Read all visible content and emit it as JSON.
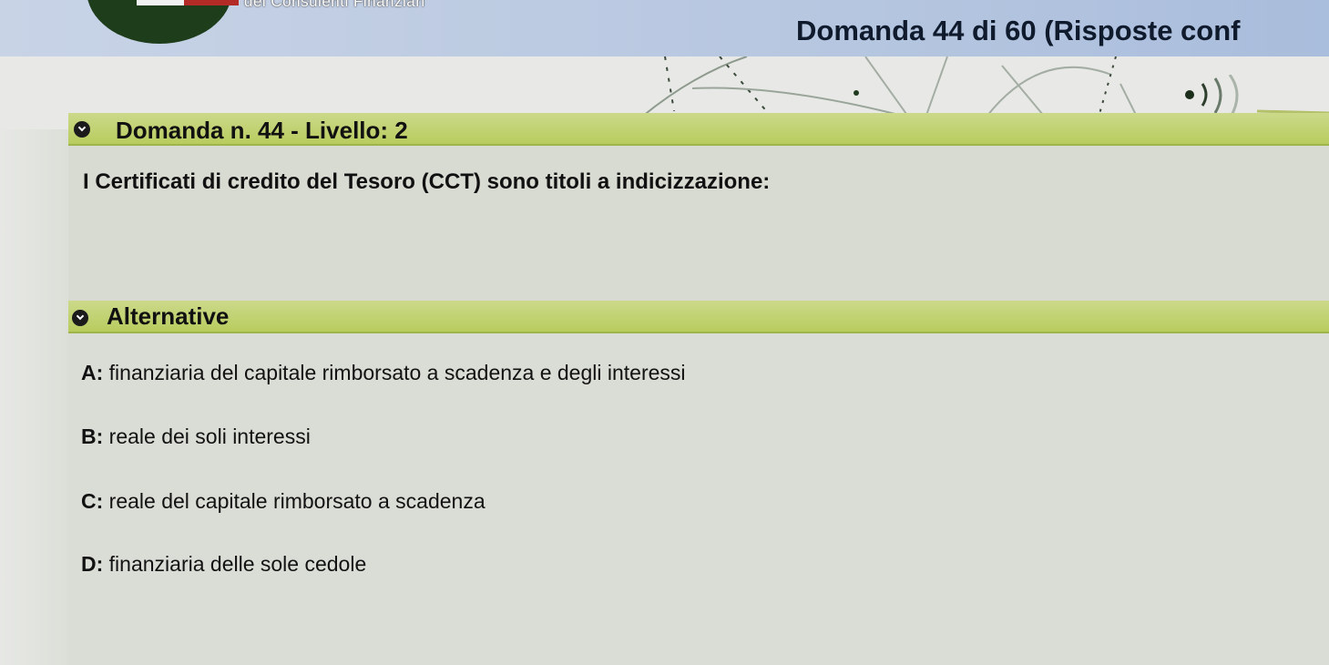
{
  "header": {
    "org_subtitle": "dei Consulenti Finanziari",
    "exam_title": "Domanda 44 di 60 (Risposte conf"
  },
  "colors": {
    "header_bg": "#b7c7e0",
    "section_bar": "#c2d274",
    "logo_green": "#1e3d1b",
    "logo_red": "#b32b27"
  },
  "icons": {
    "audio": "audio-speaker-icon",
    "section_bullet": "chevron-down-circle-icon"
  },
  "question": {
    "heading": "Domanda n. 44 - Livello: 2",
    "text": "I Certificati di credito del Tesoro (CCT) sono titoli a indicizzazione:"
  },
  "alternatives": {
    "heading": "Alternative",
    "items": [
      {
        "letter": "A:",
        "text": " finanziaria del capitale rimborsato a scadenza e degli interessi"
      },
      {
        "letter": "B:",
        "text": " reale dei soli interessi"
      },
      {
        "letter": "C:",
        "text": " reale del capitale rimborsato a scadenza"
      },
      {
        "letter": "D:",
        "text": " finanziaria delle sole cedole"
      }
    ]
  }
}
